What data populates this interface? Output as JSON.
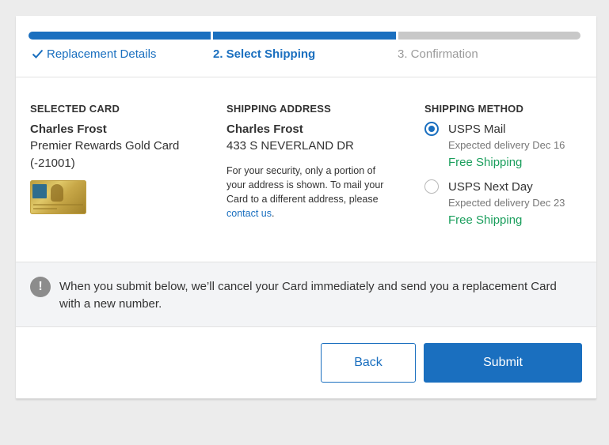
{
  "progress": {
    "steps": [
      {
        "label": "Replacement Details",
        "state": "done"
      },
      {
        "label": "2. Select Shipping",
        "state": "active"
      },
      {
        "label": "3. Confirmation",
        "state": "todo"
      }
    ]
  },
  "selected_card": {
    "heading": "SELECTED CARD",
    "holder": "Charles Frost",
    "product": "Premier Rewards Gold Card",
    "number": "(-21001)"
  },
  "shipping_address": {
    "heading": "SHIPPING ADDRESS",
    "name": "Charles Frost",
    "street": "433 S NEVERLAND DR",
    "security_note": "For your security, only a portion of your address is shown. To mail your Card to a different address, please ",
    "contact_link": "contact us",
    "security_note_end": "."
  },
  "shipping_method": {
    "heading": "SHIPPING METHOD",
    "options": [
      {
        "name": "USPS Mail",
        "eta": "Expected delivery Dec 16",
        "price": "Free Shipping",
        "selected": true
      },
      {
        "name": "USPS Next Day",
        "eta": "Expected delivery Dec 23",
        "price": "Free Shipping",
        "selected": false
      }
    ]
  },
  "notice": {
    "icon": "!",
    "text": "When you submit below, we’ll cancel your Card immediately and send you a replacement Card with a new number."
  },
  "buttons": {
    "back": "Back",
    "submit": "Submit"
  },
  "colors": {
    "accent": "#1a6fbf",
    "success": "#1a9e5c",
    "progress_inactive": "#c8c8c8"
  }
}
